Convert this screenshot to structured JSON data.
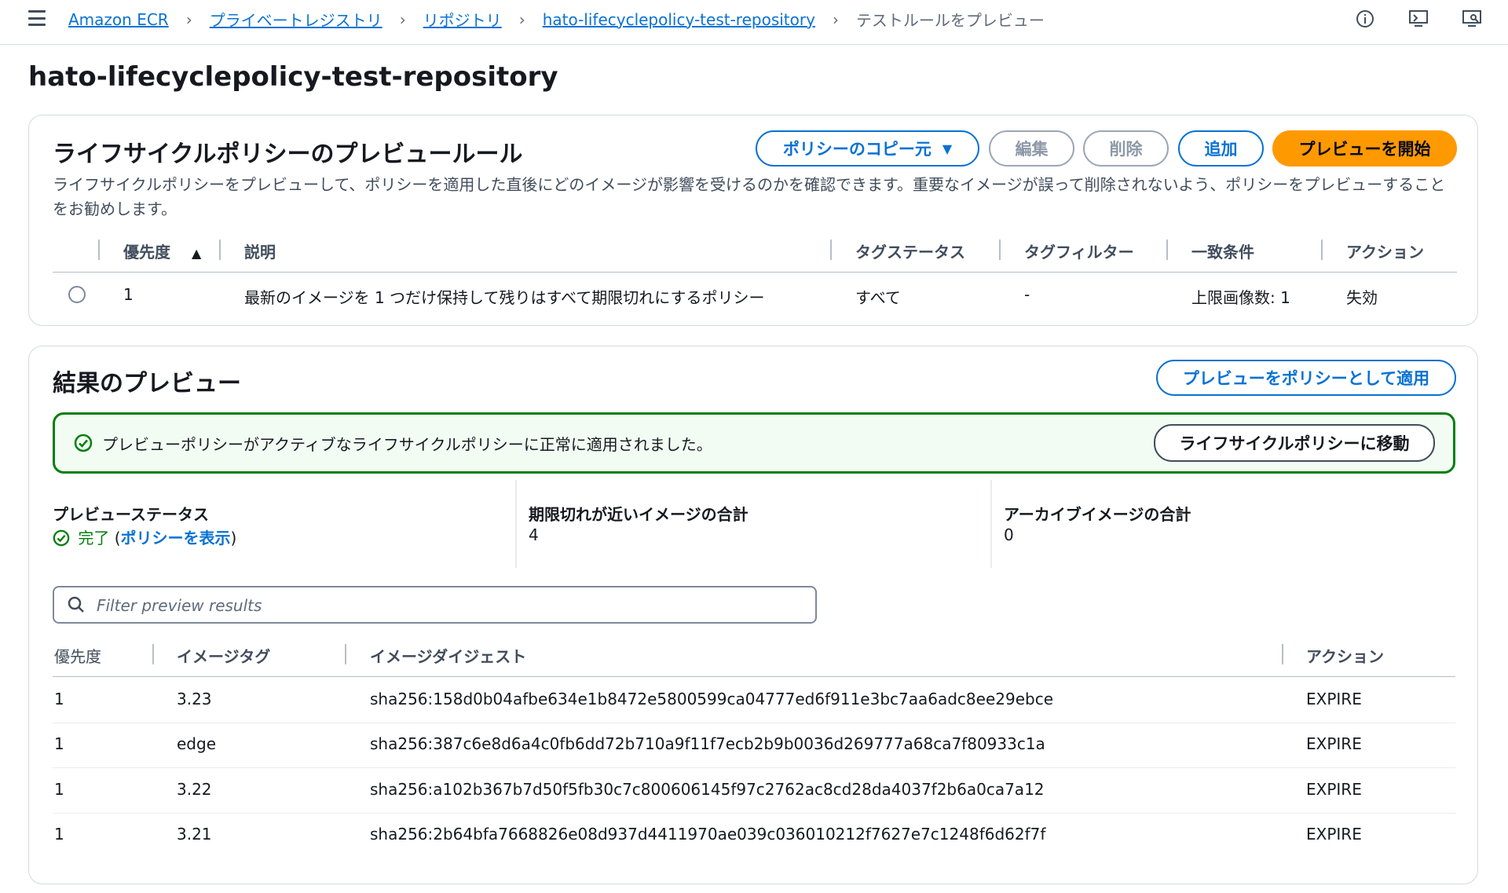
{
  "breadcrumb": {
    "items": [
      "Amazon ECR",
      "プライベートレジストリ",
      "リポジトリ",
      "hato-lifecyclepolicy-test-repository"
    ],
    "current": "テストルールをプレビュー"
  },
  "top_icons": [
    "info-icon",
    "feedback-icon",
    "preferences-icon"
  ],
  "page_title": "hato-lifecyclepolicy-test-repository",
  "rules_panel": {
    "title": "ライフサイクルポリシーのプレビュールール",
    "description": "ライフサイクルポリシーをプレビューして、ポリシーを適用した直後にどのイメージが影響を受けるのかを確認できます。重要なイメージが誤って削除されないよう、ポリシーをプレビューすることをお勧めします。",
    "buttons": {
      "copy_from": "ポリシーのコピー元",
      "edit": "編集",
      "delete": "削除",
      "add": "追加",
      "start_preview": "プレビューを開始"
    },
    "columns": {
      "priority": "優先度",
      "description": "説明",
      "tag_status": "タグステータス",
      "tag_filter": "タグフィルター",
      "match": "一致条件",
      "action": "アクション"
    },
    "rows": [
      {
        "priority": "1",
        "description": "最新のイメージを 1 つだけ保持して残りはすべて期限切れにするポリシー",
        "tag_status": "すべて",
        "tag_filter": "-",
        "match": "上限画像数: 1",
        "action": "失効"
      }
    ]
  },
  "results_panel": {
    "title": "結果のプレビュー",
    "apply_button": "プレビューをポリシーとして適用",
    "flash": {
      "message": "プレビューポリシーがアクティブなライフサイクルポリシーに正常に適用されました。",
      "button": "ライフサイクルポリシーに移動"
    },
    "stats": {
      "status_label": "プレビューステータス",
      "status_value": "完了",
      "status_link": "ポリシーを表示",
      "expiring_label": "期限切れが近いイメージの合計",
      "expiring_value": "4",
      "archived_label": "アーカイブイメージの合計",
      "archived_value": "0"
    },
    "search_placeholder": "Filter preview results",
    "columns": {
      "priority": "優先度",
      "tag": "イメージタグ",
      "digest": "イメージダイジェスト",
      "action": "アクション"
    },
    "rows": [
      {
        "priority": "1",
        "tag": "3.23",
        "digest": "sha256:158d0b04afbe634e1b8472e5800599ca04777ed6f911e3bc7aa6adc8ee29ebce",
        "action": "EXPIRE"
      },
      {
        "priority": "1",
        "tag": "edge",
        "digest": "sha256:387c6e8d6a4c0fb6dd72b710a9f11f7ecb2b9b0036d269777a68ca7f80933c1a",
        "action": "EXPIRE"
      },
      {
        "priority": "1",
        "tag": "3.22",
        "digest": "sha256:a102b367b7d50f5fb30c7c800606145f97c2762ac8cd28da4037f2b6a0ca7a12",
        "action": "EXPIRE"
      },
      {
        "priority": "1",
        "tag": "3.21",
        "digest": "sha256:2b64bfa7668826e08d937d4411970ae039c036010212f7627e7c1248f6d62f7f",
        "action": "EXPIRE"
      }
    ]
  },
  "colors": {
    "link": "#0972d3",
    "primary": "#ff9900",
    "success": "#037f0c",
    "success_bg": "#f2fcf3"
  }
}
